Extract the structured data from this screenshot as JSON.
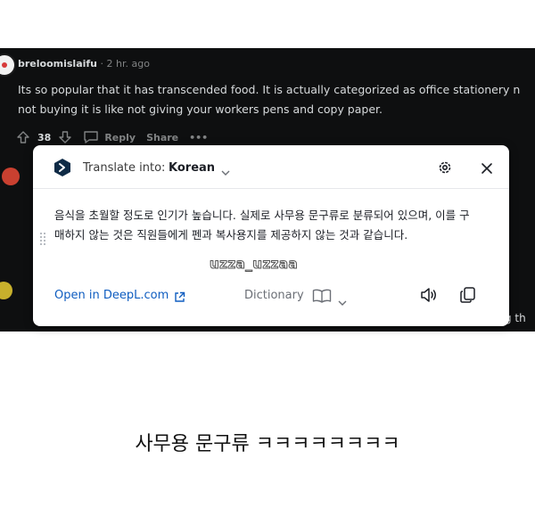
{
  "comment": {
    "username": "breloomislaifu",
    "separator": "·",
    "time": "2 hr. ago",
    "body_lines": [
      "Its so popular that it has transcended food. It is actually categorized as office stationery n",
      "not buying it is like not giving your workers pens and copy paper."
    ],
    "votes": "38",
    "reply_label": "Reply",
    "share_label": "Share",
    "more_label": "•••",
    "clipped_right_text": "g th"
  },
  "translator": {
    "translate_into_label": "Translate into:",
    "target_language": "Korean",
    "translation_lines": [
      "음식을 초월할 정도로 인기가 높습니다. 실제로 사무용 문구류로 분류되어 있으며, 이를 구",
      "매하지 않는 것은 직원들에게 펜과 복사용지를 제공하지 않는 것과 같습니다."
    ],
    "watermark": "uzza_uzzaa",
    "open_link_label": "Open in DeepL.com",
    "dictionary_label": "Dictionary"
  },
  "caption": "사무용 문구류 ㅋㅋㅋㅋㅋㅋㅋㅋ",
  "colors": {
    "dark_background": "#0e0f10",
    "link_blue": "#0f5dc0",
    "deepl_navy": "#0f2b46"
  }
}
